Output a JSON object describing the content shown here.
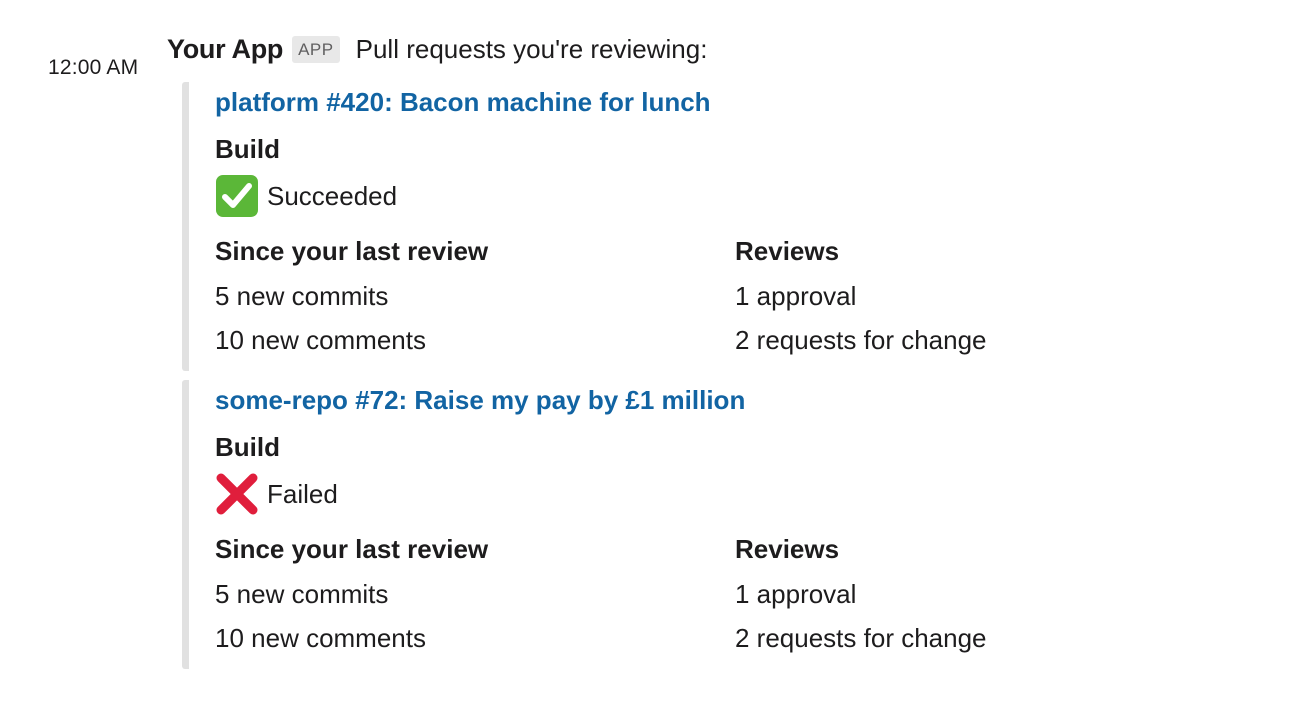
{
  "message": {
    "timestamp": "12:00 AM",
    "app_name": "Your App",
    "app_badge": "APP",
    "text": "Pull requests you're reviewing:"
  },
  "attachments": [
    {
      "title": "platform #420: Bacon machine for lunch",
      "build_label": "Build",
      "build_status": "Succeeded",
      "status_icon": "check-mark-icon",
      "status_color": "#5bb738",
      "since_title": "Since your last review",
      "since_lines": [
        "5 new commits",
        "10 new comments"
      ],
      "reviews_title": "Reviews",
      "reviews_lines": [
        "1 approval",
        "2 requests for change"
      ]
    },
    {
      "title": "some-repo #72: Raise my pay by £1 million",
      "build_label": "Build",
      "build_status": "Failed",
      "status_icon": "cross-mark-icon",
      "status_color": "#e01e3c",
      "since_title": "Since your last review",
      "since_lines": [
        "5 new commits",
        "10 new comments"
      ],
      "reviews_title": "Reviews",
      "reviews_lines": [
        "1 approval",
        "2 requests for change"
      ]
    }
  ],
  "colors": {
    "link": "#1264a3",
    "text": "#1d1c1d",
    "border": "#e1e1e1",
    "badge_bg": "#e8e8e8"
  }
}
